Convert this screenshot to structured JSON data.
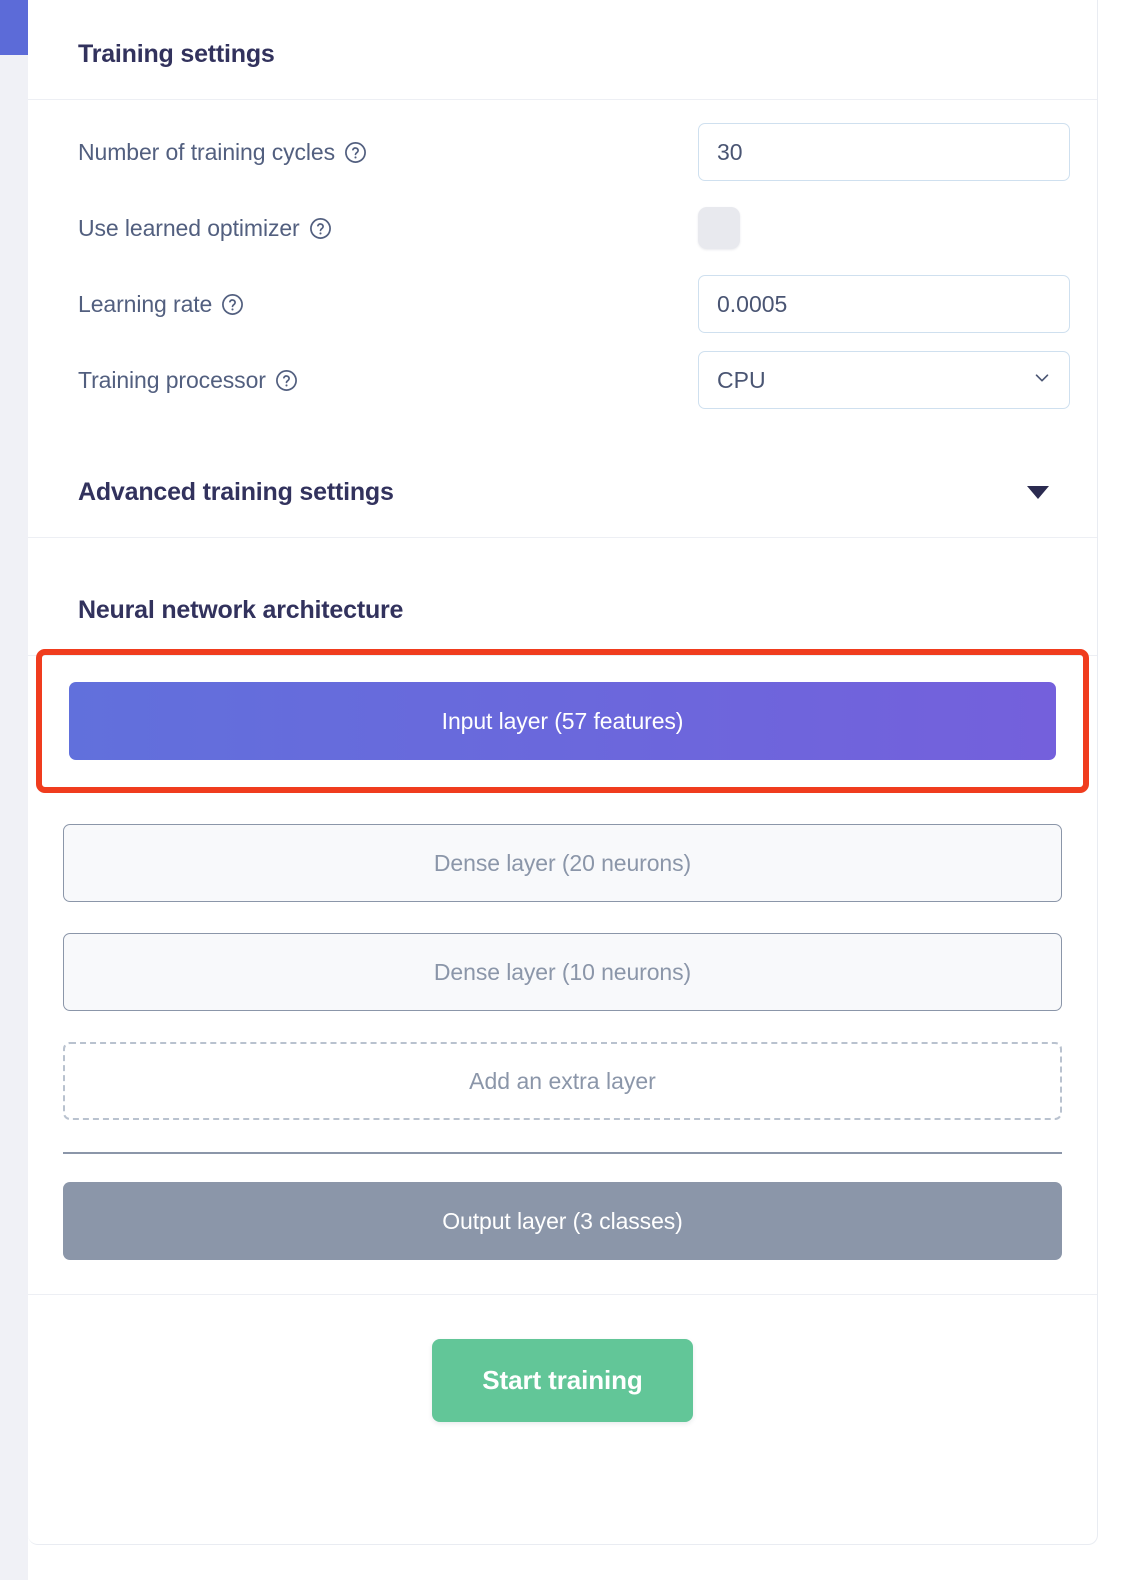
{
  "training_settings": {
    "title": "Training settings",
    "rows": [
      {
        "label": "Number of training cycles",
        "help_icon": "help-circle-icon",
        "value": "30",
        "type": "number"
      },
      {
        "label": "Use learned optimizer",
        "help_icon": "help-circle-icon",
        "value": "",
        "type": "checkbox",
        "checked": false
      },
      {
        "label": "Learning rate",
        "help_icon": "help-circle-icon",
        "value": "0.0005",
        "type": "number"
      },
      {
        "label": "Training processor",
        "help_icon": "help-circle-icon",
        "value": "CPU",
        "type": "select"
      }
    ]
  },
  "advanced_settings": {
    "title": "Advanced training settings",
    "caret_icon": "caret-down-icon",
    "expanded": false
  },
  "neural_network": {
    "title": "Neural network architecture",
    "input_layer": "Input layer (57 features)",
    "hidden_layers": [
      "Dense layer (20 neurons)",
      "Dense layer (10 neurons)"
    ],
    "add_layer": "Add an extra layer",
    "output_layer": "Output layer (3 classes)"
  },
  "footer": {
    "start_training": "Start training"
  },
  "colors": {
    "accent_blue": "#5c6bd8",
    "input_gradient_start": "#6170dc",
    "input_gradient_end": "#7460dc",
    "output_layer": "#8b96a9",
    "start_button": "#62c698",
    "highlight_red": "#f03c1e",
    "heading_text": "#32325d",
    "label_text": "#525f7f"
  }
}
